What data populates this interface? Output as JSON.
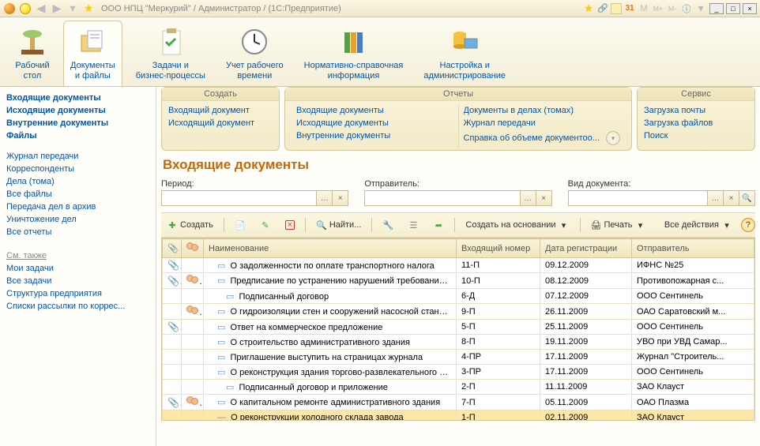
{
  "titlebar": {
    "title": "ООО НПЦ \"Меркурий\" / Администратор /  (1С:Предприятие)"
  },
  "sections": [
    {
      "label": "Рабочий\nстол"
    },
    {
      "label": "Документы\nи файлы",
      "active": true
    },
    {
      "label": "Задачи и\nбизнес-процессы"
    },
    {
      "label": "Учет рабочего\nвремени"
    },
    {
      "label": "Нормативно-справочная\nинформация"
    },
    {
      "label": "Настройка и\nадминистрирование"
    }
  ],
  "sidebar": {
    "primary": [
      "Входящие документы",
      "Исходящие документы",
      "Внутренние документы",
      "Файлы"
    ],
    "secondary": [
      "Журнал передачи",
      "Корреспонденты",
      "Дела (тома)",
      "Все файлы",
      "Передача дел в архив",
      "Уничтожение дел",
      "Все отчеты"
    ],
    "see_also_label": "См. также",
    "see_also": [
      "Мои задачи",
      "Все задачи",
      "Структура предприятия",
      "Списки рассылки по коррес..."
    ]
  },
  "cmd_panels": {
    "create": {
      "title": "Создать",
      "items": [
        "Входящий документ",
        "Исходящий документ"
      ]
    },
    "reports": {
      "title": "Отчеты",
      "col1": [
        "Входящие документы",
        "Исходящие документы",
        "Внутренние документы"
      ],
      "col2": [
        "Документы в делах (томах)",
        "Журнал передачи",
        "Справка об объеме документоо..."
      ]
    },
    "service": {
      "title": "Сервис",
      "items": [
        "Загрузка почты",
        "Загрузка файлов",
        "Поиск"
      ]
    }
  },
  "page": {
    "title": "Входящие документы",
    "filters": {
      "period_label": "Период:",
      "sender_label": "Отправитель:",
      "type_label": "Вид документа:"
    },
    "toolbar": {
      "create": "Создать",
      "find": "Найти...",
      "create_based": "Создать на основании",
      "print": "Печать",
      "all_actions": "Все действия"
    },
    "columns": {
      "name": "Наименование",
      "num": "Входящий номер",
      "date": "Дата регистрации",
      "sender": "Отправитель"
    },
    "rows": [
      {
        "clip": true,
        "users": false,
        "indent": 1,
        "name": "О задолженности по оплате транспортного налога",
        "num": "11-П",
        "date": "09.12.2009",
        "sender": "ИФНС №25"
      },
      {
        "clip": true,
        "users": true,
        "indent": 1,
        "name": "Предписание по устранению нарушений требований п...",
        "num": "10-П",
        "date": "08.12.2009",
        "sender": "Противопожарная с..."
      },
      {
        "clip": false,
        "users": false,
        "indent": 2,
        "name": "Подписанный договор",
        "num": "6-Д",
        "date": "07.12.2009",
        "sender": "ООО Сентинель"
      },
      {
        "clip": false,
        "users": true,
        "indent": 1,
        "name": "О гидроизоляции стен и сооружений насосной станции",
        "num": "9-П",
        "date": "26.11.2009",
        "sender": "ОАО Саратовский м..."
      },
      {
        "clip": true,
        "users": false,
        "indent": 1,
        "name": "Ответ на коммерческое предложение",
        "num": "5-П",
        "date": "25.11.2009",
        "sender": "ООО Сентинель"
      },
      {
        "clip": false,
        "users": false,
        "indent": 1,
        "name": "О строительство административного здания",
        "num": "8-П",
        "date": "19.11.2009",
        "sender": "УВО при УВД Самар..."
      },
      {
        "clip": false,
        "users": false,
        "indent": 1,
        "name": "Приглашение выступить на страницах журнала",
        "num": "4-ПР",
        "date": "17.11.2009",
        "sender": "Журнал \"Строитель..."
      },
      {
        "clip": false,
        "users": false,
        "indent": 1,
        "name": "О реконструкция здания торгово-развлекательного ц...",
        "num": "3-ПР",
        "date": "17.11.2009",
        "sender": "ООО Сентинель"
      },
      {
        "clip": false,
        "users": false,
        "indent": 2,
        "name": "Подписанный договор и приложение",
        "num": "2-П",
        "date": "11.11.2009",
        "sender": "ЗАО Клауст"
      },
      {
        "clip": true,
        "users": true,
        "indent": 1,
        "name": "О капитальном ремонте административного здания",
        "num": "7-П",
        "date": "05.11.2009",
        "sender": "ОАО Плазма"
      },
      {
        "clip": false,
        "users": false,
        "indent": 1,
        "name": "О реконструкции холодного склада завода",
        "num": "1-П",
        "date": "02.11.2009",
        "sender": "ЗАО Клауст",
        "selected": true
      }
    ]
  }
}
